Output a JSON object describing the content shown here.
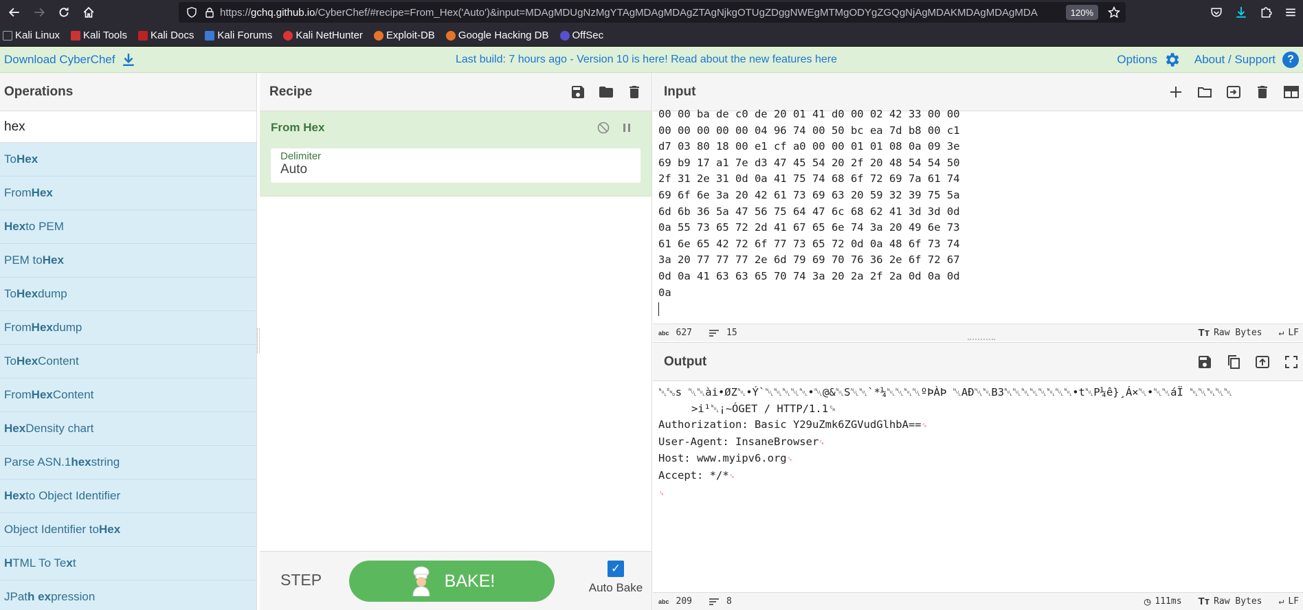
{
  "browser": {
    "url_prefix": "https://",
    "url_host": "gchq.github.io",
    "url_rest": "/CyberChef/#recipe=From_Hex('Auto')&input=MDAgMDUgNzMgYTAgMDAgMDAgZTAgNjkgOTUgZDggNWEgMTMgODYgZGQgNjAgMDAKMDAgMDAgMDA",
    "zoom": "120%",
    "bookmarks": [
      "Kali Linux",
      "Kali Tools",
      "Kali Docs",
      "Kali Forums",
      "Kali NetHunter",
      "Exploit-DB",
      "Google Hacking DB",
      "OffSec"
    ]
  },
  "banner": {
    "download": "Download CyberChef",
    "notice": "Last build: 7 hours ago - Version 10 is here! Read about the new features here",
    "options": "Options",
    "about": "About / Support"
  },
  "operations": {
    "title": "Operations",
    "search_value": "hex",
    "items": [
      {
        "pre": "To ",
        "bold": "Hex",
        "post": ""
      },
      {
        "pre": "From ",
        "bold": "Hex",
        "post": ""
      },
      {
        "pre": "",
        "bold": "Hex",
        "post": " to PEM"
      },
      {
        "pre": "PEM to ",
        "bold": "Hex",
        "post": ""
      },
      {
        "pre": "To ",
        "bold": "Hex",
        "post": "dump"
      },
      {
        "pre": "From ",
        "bold": "Hex",
        "post": "dump"
      },
      {
        "pre": "To ",
        "bold": "Hex",
        "post": " Content"
      },
      {
        "pre": "From ",
        "bold": "Hex",
        "post": " Content"
      },
      {
        "pre": "",
        "bold": "Hex",
        "post": " Density chart"
      },
      {
        "pre": "Parse ASN.1 ",
        "bold": "hex",
        "post": " string"
      },
      {
        "pre": "",
        "bold": "Hex",
        "post": " to Object Identifier"
      },
      {
        "pre": "Object Identifier to ",
        "bold": "Hex",
        "post": ""
      },
      {
        "pre": "",
        "bold": "H",
        "post": "TML To Te",
        "bold2": "x",
        "post2": "t"
      },
      {
        "pre": "JPat",
        "bold": "h ex",
        "post": "pression"
      }
    ]
  },
  "recipe": {
    "title": "Recipe",
    "op_name": "From Hex",
    "arg_label": "Delimiter",
    "arg_value": "Auto",
    "step": "STEP",
    "bake": "BAKE!",
    "auto_bake": "Auto Bake"
  },
  "input": {
    "title": "Input",
    "lines": [
      "00 00 ba de c0 de 20 01 41 d0 00 02 42 33 00 00",
      "00 00 00 00 00 04 96 74 00 50 bc ea 7d b8 00 c1",
      "d7 03 80 18 00 e1 cf a0 00 00 01 01 08 0a 09 3e",
      "69 b9 17 a1 7e d3 47 45 54 20 2f 20 48 54 54 50",
      "2f 31 2e 31 0d 0a 41 75 74 68 6f 72 69 7a 61 74",
      "69 6f 6e 3a 20 42 61 73 69 63 20 59 32 39 75 5a",
      "6d 6b 36 5a 47 56 75 64 47 6c 68 62 41 3d 3d 0d",
      "0a 55 73 65 72 2d 41 67 65 6e 74 3a 20 49 6e 73",
      "61 6e 65 42 72 6f 77 73 65 72 0d 0a 48 6f 73 74",
      "3a 20 77 77 77 2e 6d 79 69 70 76 36 2e 6f 72 67",
      "0d 0a 41 63 63 65 70 74 3a 20 2a 2f 2a 0d 0a 0d",
      "0a"
    ],
    "chars": "627",
    "line_count": "15",
    "encoding": "Raw Bytes",
    "eol": "LF"
  },
  "output": {
    "title": "Output",
    "line1": "␀␅s ␀␀ài•ØZ␀•Ý`␀␀␀␀␀•␀@&␀S␀␀`*¼␀␀␀␀ºÞÀÞ ␀AÐ␀␀B3␀␀␀␀␀␀␀␀•t␀P¼ê}¸Á×␀•␀␀áÏ ␀␀␀␀␀",
    "line2": ">i¹␀¡~ÓGET / HTTP/1.1␍",
    "line3": "Authorization: Basic Y29uZmk6ZGVudGlhbA==",
    "line4": "User-Agent: InsaneBrowser",
    "line5": "Host: www.myipv6.org",
    "line6": "Accept: */*",
    "chars": "209",
    "line_count": "8",
    "time": "111ms",
    "encoding": "Raw Bytes",
    "eol": "LF"
  }
}
